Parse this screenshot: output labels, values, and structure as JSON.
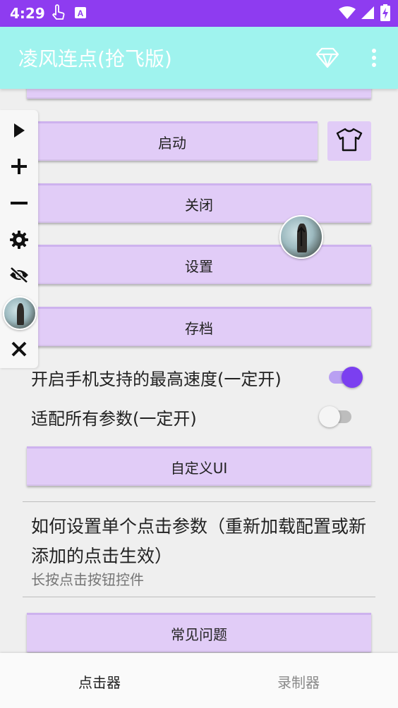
{
  "status_bar": {
    "time": "4:29",
    "icons": [
      "touch-icon",
      "a-badge-icon",
      "wifi-icon",
      "signal-icon",
      "battery-charging-icon"
    ],
    "color": "#8e3cf0"
  },
  "app_bar": {
    "title": "凌风连点(抢飞版)",
    "icons": [
      "diamond-icon",
      "more-vert-icon"
    ],
    "color": "#9ff3ee"
  },
  "buttons": {
    "start": "启动",
    "close": "关闭",
    "settings": "设置",
    "archive": "存档",
    "custom_ui": "自定义UI",
    "faq": "常见问题"
  },
  "toggles": {
    "max_speed": {
      "label": "开启手机支持的最高速度(一定开)",
      "on": true
    },
    "fit_params": {
      "label": "适配所有参数(一定开)",
      "on": false
    }
  },
  "faq": {
    "title": "如何设置单个点击参数（重新加载配置或新添加的点击生效）",
    "subtitle": "长按点击按钮控件"
  },
  "floating_toolbar": {
    "icons": [
      "play-icon",
      "plus-icon",
      "minus-icon",
      "gear-icon",
      "eye-off-icon",
      "avatar",
      "close-icon"
    ]
  },
  "bottom_nav": {
    "tabs": [
      {
        "label": "点击器",
        "active": true
      },
      {
        "label": "录制器",
        "active": false
      }
    ]
  },
  "colors": {
    "button_bg": "#e1ccf7",
    "switch_on": "#7b3ff0",
    "switch_on_track": "#b9a0f2"
  }
}
